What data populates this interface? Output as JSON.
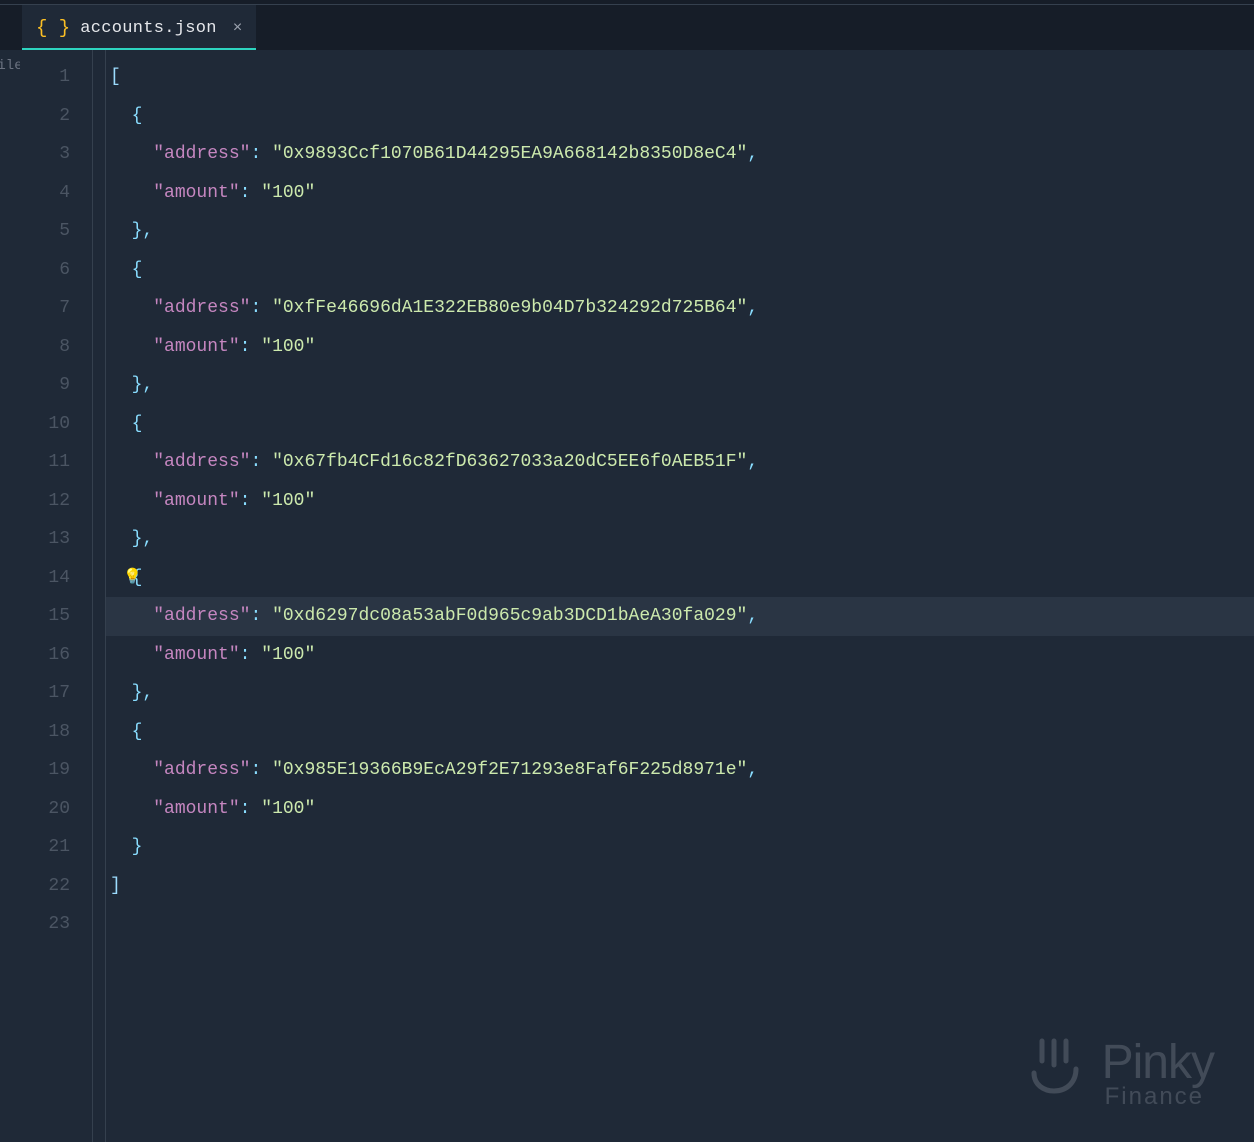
{
  "tab": {
    "filename": "accounts.json",
    "close_glyph": "×",
    "file_icon_glyph": "{ }"
  },
  "sidebar_sliver_text": "ile",
  "highlighted_line": 15,
  "bulb_line": 14,
  "code": {
    "key_address": "\"address\"",
    "key_amount": "\"amount\"",
    "entries": [
      {
        "address": "\"0x9893Ccf1070B61D44295EA9A668142b8350D8eC4\"",
        "amount": "\"100\""
      },
      {
        "address": "\"0xfFe46696dA1E322EB80e9b04D7b324292d725B64\"",
        "amount": "\"100\""
      },
      {
        "address": "\"0x67fb4CFd16c82fD63627033a20dC5EE6f0AEB51F\"",
        "amount": "\"100\""
      },
      {
        "address": "\"0xd6297dc08a53abF0d965c9ab3DCD1bAeA30fa029\"",
        "amount": "\"100\""
      },
      {
        "address": "\"0x985E19366B9EcA29f2E71293e8Faf6F225d8971e\"",
        "amount": "\"100\""
      }
    ]
  },
  "line_numbers": [
    "1",
    "2",
    "3",
    "4",
    "5",
    "6",
    "7",
    "8",
    "9",
    "10",
    "11",
    "12",
    "13",
    "14",
    "15",
    "16",
    "17",
    "18",
    "19",
    "20",
    "21",
    "22",
    "23"
  ],
  "watermark": {
    "brand": "Pinky",
    "sub": "Finance"
  }
}
